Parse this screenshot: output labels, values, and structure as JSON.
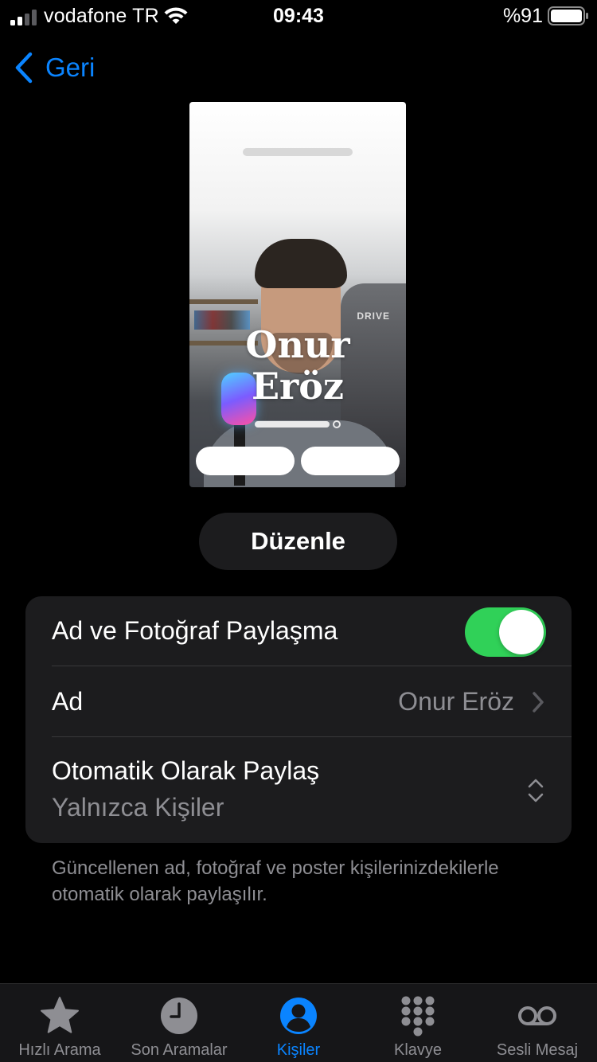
{
  "status_bar": {
    "carrier": "vodafone TR",
    "time": "09:43",
    "battery_percent": "%91",
    "battery_level": 0.91
  },
  "nav": {
    "back_label": "Geri"
  },
  "poster": {
    "first_name": "Onur",
    "last_name": "Eröz",
    "chair_logo": "DRIVE"
  },
  "edit_button": "Düzenle",
  "settings": {
    "share_toggle_label": "Ad ve Fotoğraf Paylaşma",
    "share_toggle_on": true,
    "name_label": "Ad",
    "name_value": "Onur Eröz",
    "auto_share_label": "Otomatik Olarak Paylaş",
    "auto_share_value": "Yalnızca Kişiler"
  },
  "footnote": "Güncellenen ad, fotoğraf ve poster kişilerinizdekilerle otomatik olarak paylaşılır.",
  "colors": {
    "accent": "#0a84ff",
    "toggle_on": "#30d158",
    "background": "#000000",
    "group_bg": "#1c1c1e",
    "secondary_text": "#8e8e93"
  },
  "tabbar": {
    "tabs": [
      {
        "label": "Hızlı Arama",
        "icon": "star-icon",
        "active": false
      },
      {
        "label": "Son Aramalar",
        "icon": "clock-icon",
        "active": false
      },
      {
        "label": "Kişiler",
        "icon": "person-circle-icon",
        "active": true
      },
      {
        "label": "Klavye",
        "icon": "keypad-icon",
        "active": false
      },
      {
        "label": "Sesli Mesaj",
        "icon": "voicemail-icon",
        "active": false
      }
    ]
  }
}
